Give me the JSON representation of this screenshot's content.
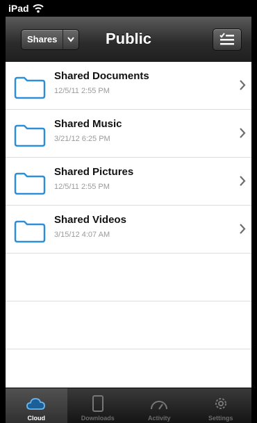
{
  "status_bar": {
    "device": "iPad"
  },
  "nav": {
    "title": "Public",
    "shares_label": "Shares"
  },
  "items": [
    {
      "name": "Shared Documents",
      "date": "12/5/11 2:55 PM"
    },
    {
      "name": "Shared Music",
      "date": "3/21/12 6:25 PM"
    },
    {
      "name": "Shared Pictures",
      "date": "12/5/11 2:55 PM"
    },
    {
      "name": "Shared Videos",
      "date": "3/15/12 4:07 AM"
    }
  ],
  "tabs": [
    {
      "label": "Cloud",
      "icon": "cloud-icon",
      "active": true
    },
    {
      "label": "Downloads",
      "icon": "tablet-icon",
      "active": false
    },
    {
      "label": "Activity",
      "icon": "gauge-icon",
      "active": false
    },
    {
      "label": "Settings",
      "icon": "gear-icon",
      "active": false
    }
  ],
  "colors": {
    "folder": "#2e8fd8",
    "accent": "#4aa3e0"
  }
}
